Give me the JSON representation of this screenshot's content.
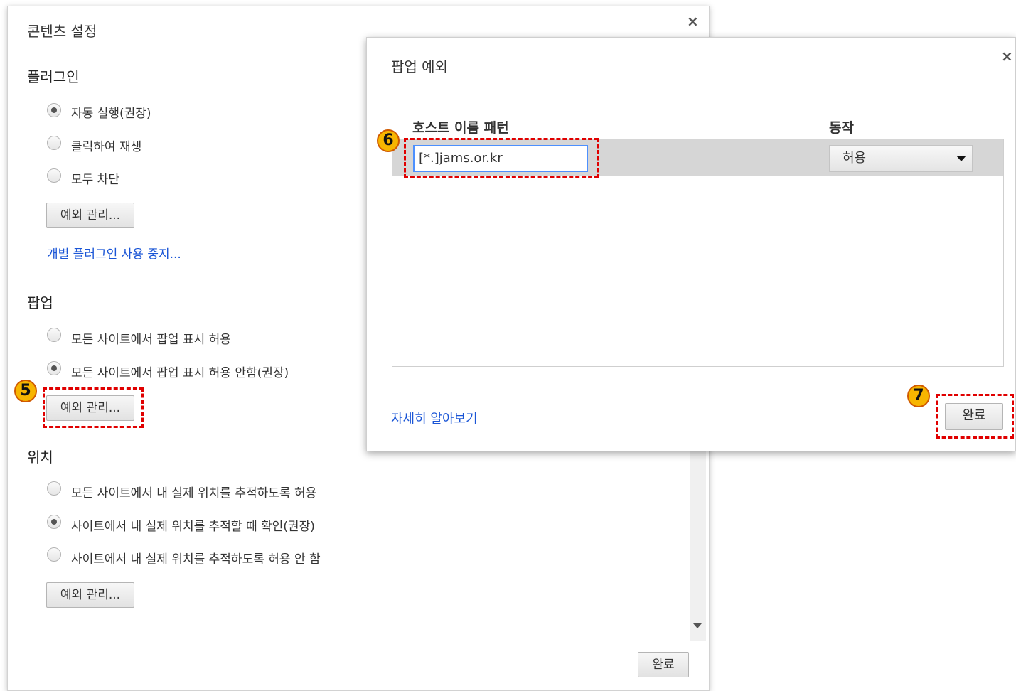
{
  "content_settings": {
    "title": "콘텐츠 설정",
    "close": "×",
    "plugins": {
      "title": "플러그인",
      "options": [
        "자동 실행(권장)",
        "클릭하여 재생",
        "모두 차단"
      ],
      "selected": 0,
      "manage_button": "예외 관리...",
      "disable_link": "개별 플러그인 사용 중지..."
    },
    "popups": {
      "title": "팝업",
      "options": [
        "모든 사이트에서 팝업 표시 허용",
        "모든 사이트에서 팝업 표시 허용 안함(권장)"
      ],
      "selected": 1,
      "manage_button": "예외 관리..."
    },
    "location": {
      "title": "위치",
      "options": [
        "모든 사이트에서 내 실제 위치를 추적하도록 허용",
        "사이트에서 내 실제 위치를 추적할 때 확인(권장)",
        "사이트에서 내 실제 위치를 추적하도록 허용 안 함"
      ],
      "selected": 1,
      "manage_button": "예외 관리..."
    },
    "done_button": "완료"
  },
  "popup_exceptions": {
    "title": "팝업 예외",
    "close": "×",
    "col_host": "호스트 이름 패턴",
    "col_action": "동작",
    "host_value": "[*.]jams.or.kr",
    "action_value": "허용",
    "learn_more": "자세히 알아보기",
    "done_button": "완료"
  },
  "annotations": {
    "step5": "5",
    "step6": "6",
    "step7": "7",
    "highlight_color": "#e00000",
    "badge_color": "#f7b500"
  }
}
